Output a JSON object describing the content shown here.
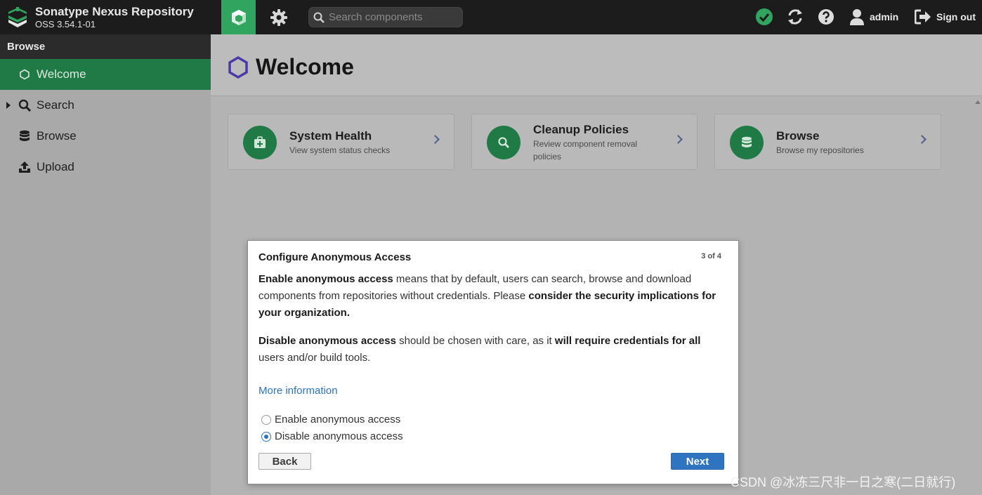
{
  "header": {
    "brand_title": "Sonatype Nexus Repository",
    "brand_version": "OSS 3.54.1-01",
    "search_placeholder": "Search components",
    "user_label": "admin",
    "signout_label": "Sign out"
  },
  "sidebar": {
    "title": "Browse",
    "items": [
      {
        "label": "Welcome",
        "icon": "hexagon-icon",
        "active": true
      },
      {
        "label": "Search",
        "icon": "search-icon",
        "active": false
      },
      {
        "label": "Browse",
        "icon": "database-icon",
        "active": false
      },
      {
        "label": "Upload",
        "icon": "upload-icon",
        "active": false
      }
    ]
  },
  "main": {
    "title": "Welcome",
    "cards": [
      {
        "title": "System Health",
        "description": "View system status checks",
        "icon": "medkit-icon"
      },
      {
        "title": "Cleanup Policies",
        "description": "Review component removal policies",
        "icon": "search-icon"
      },
      {
        "title": "Browse",
        "description": "Browse my repositories",
        "icon": "database-icon"
      }
    ]
  },
  "modal": {
    "title": "Configure Anonymous Access",
    "step": "3 of 4",
    "p1": {
      "b1": "Enable anonymous access",
      "t1": " means that by default, users can search, browse and download components from repositories without credentials. Please ",
      "b2": "consider the security implications for your organization."
    },
    "p2": {
      "b1": "Disable anonymous access",
      "t1": " should be chosen with care, as it ",
      "b2": "will require credentials for all",
      "t2": " users and/or build tools."
    },
    "more_info": "More information",
    "options": [
      {
        "label": "Enable anonymous access",
        "checked": false
      },
      {
        "label": "Disable anonymous access",
        "checked": true
      }
    ],
    "back_label": "Back",
    "next_label": "Next"
  },
  "watermark": "CSDN @冰冻三尺非一日之寒(二日就行)",
  "colors": {
    "brand_green": "#2fa55f",
    "active_green": "#1f7a45",
    "link_blue": "#2f74b8",
    "button_blue": "#2f74c0"
  }
}
